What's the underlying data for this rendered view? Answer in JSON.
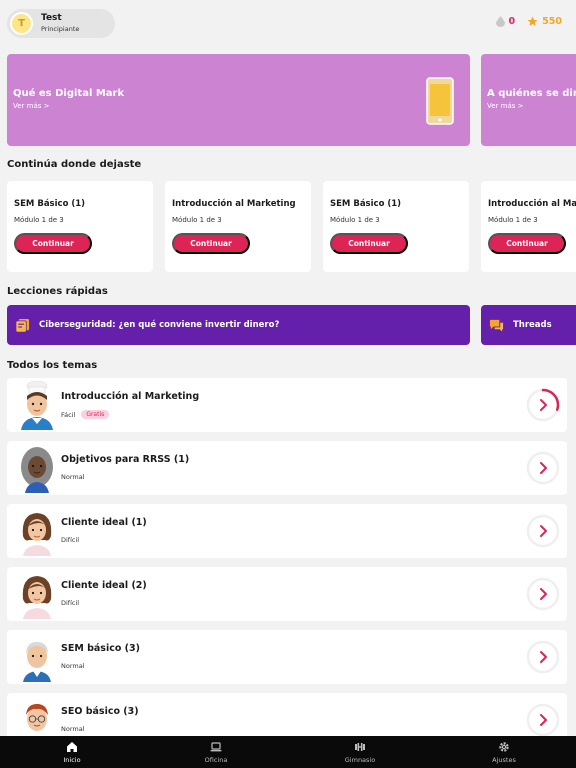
{
  "header": {
    "avatar_initial": "T",
    "user_name": "Test",
    "user_level": "Principiante",
    "drops": "0",
    "stars": "550"
  },
  "banners": [
    {
      "title": "Qué es Digital Mark",
      "link": "Ver más >"
    },
    {
      "title": "A quiénes se dirige",
      "link": "Ver más >"
    }
  ],
  "sections": {
    "continue": "Continúa donde dejaste",
    "quick": "Lecciones rápidas",
    "all": "Todos los temas"
  },
  "continue_cards": [
    {
      "title": "SEM Básico (1)",
      "module": "Módulo 1 de 3",
      "button": "Continuar"
    },
    {
      "title": "Introducción al Marketing",
      "module": "Módulo 1 de 3",
      "button": "Continuar"
    },
    {
      "title": "SEM Básico (1)",
      "module": "Módulo 1 de 3",
      "button": "Continuar"
    },
    {
      "title": "Introducción al Marketing",
      "module": "Módulo 1 de 3",
      "button": "Continuar"
    }
  ],
  "quick_lessons": [
    {
      "label": "Ciberseguridad: ¿en qué conviene invertir dinero?"
    },
    {
      "label": "Threads"
    }
  ],
  "topics": [
    {
      "title": "Introducción al Marketing",
      "level": "Fácil",
      "badge": "Gratis",
      "progress": 0.3,
      "avatar": "chef-man"
    },
    {
      "title": "Objetivos para RRSS (1)",
      "level": "Normal",
      "progress": 0,
      "avatar": "woman-gray-curly"
    },
    {
      "title": "Cliente ideal (1)",
      "level": "Difícil",
      "progress": 0,
      "avatar": "woman-brown"
    },
    {
      "title": "Cliente ideal (2)",
      "level": "Difícil",
      "progress": 0,
      "avatar": "woman-brown"
    },
    {
      "title": "SEM básico (3)",
      "level": "Normal",
      "progress": 0,
      "avatar": "old-man"
    },
    {
      "title": "SEO básico (3)",
      "level": "Normal",
      "progress": 0,
      "avatar": "man-red-hair-glasses"
    }
  ],
  "tabs": [
    {
      "label": "Inicio",
      "icon": "home-icon",
      "active": true
    },
    {
      "label": "Oficina",
      "icon": "laptop-icon",
      "active": false
    },
    {
      "label": "Gimnasio",
      "icon": "dumbbell-icon",
      "active": false
    },
    {
      "label": "Ajustes",
      "icon": "gear-icon",
      "active": false
    }
  ],
  "colors": {
    "accent": "#dc2456",
    "banner": "#cc84d2",
    "quick": "#6420aa",
    "star": "#f5a623"
  }
}
